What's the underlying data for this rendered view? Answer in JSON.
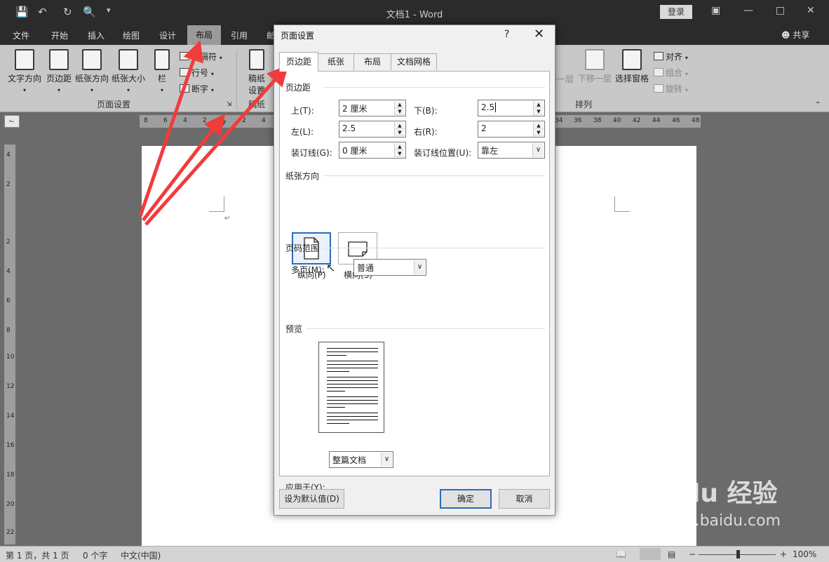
{
  "window": {
    "title": "文档1  -  Word",
    "login_label": "登录",
    "share_label": "共享"
  },
  "tabs": [
    "文件",
    "开始",
    "插入",
    "绘图",
    "设计",
    "布局",
    "引用",
    "邮"
  ],
  "active_tab": "布局",
  "ribbon": {
    "page_setup": {
      "text_direction": "文字方向",
      "margins": "页边距",
      "orientation": "纸张方向",
      "size": "纸张大小",
      "columns": "栏",
      "breaks": "分隔符",
      "line_numbers": "行号",
      "hyphenation": "断字",
      "group_label": "页面设置"
    },
    "draft": {
      "label_line1": "稿纸",
      "label_line2": "设置",
      "group_label": "稿纸"
    },
    "arrange": {
      "bring_forward": "上移一层",
      "send_backward": "下移一层",
      "selection_pane": "选择窗格",
      "align": "对齐",
      "group": "组合",
      "rotate": "旋转",
      "group_label": "排列"
    }
  },
  "ruler": {
    "h_left": [
      "8",
      "6",
      "4",
      "2",
      "2",
      "4"
    ],
    "h_right": [
      "34",
      "36",
      "38",
      "40",
      "42",
      "44",
      "46",
      "48"
    ],
    "v": [
      "4",
      "2",
      "2",
      "4",
      "6",
      "8",
      "10",
      "12",
      "14",
      "16",
      "18",
      "20",
      "22"
    ]
  },
  "dialog": {
    "title": "页面设置",
    "help": "?",
    "tabs": [
      "页边距",
      "纸张",
      "布局",
      "文档网格"
    ],
    "active_tab": "页边距",
    "margins_section": "页边距",
    "top_label": "上(T):",
    "top_value": "2 厘米",
    "bottom_label": "下(B):",
    "bottom_value": "2.5",
    "left_label": "左(L):",
    "left_value": "2.5",
    "right_label": "右(R):",
    "right_value": "2",
    "gutter_label": "装订线(G):",
    "gutter_value": "0 厘米",
    "gutter_pos_label": "装订线位置(U):",
    "gutter_pos_value": "靠左",
    "orientation_section": "纸张方向",
    "portrait_label": "纵向(P)",
    "landscape_label": "横向(S)",
    "pages_section": "页码范围",
    "multiple_pages_label": "多页(M):",
    "multiple_pages_value": "普通",
    "preview_section": "预览",
    "apply_to_label": "应用于(Y):",
    "apply_to_value": "整篇文档",
    "set_default_button": "设为默认值(D)",
    "ok_button": "确定",
    "cancel_button": "取消"
  },
  "status": {
    "page": "第 1 页，共 1 页",
    "words": "0 个字",
    "language": "中文(中国)",
    "zoom": "100%"
  },
  "watermark": {
    "brand": "Bai du 经验",
    "url": "jingyan.baidu.com"
  },
  "colors": {
    "accent": "#2d6cb5",
    "arrow": "#f03c3c",
    "titlebar": "#2b2b2b",
    "ribbon": "#c8c8c8"
  }
}
